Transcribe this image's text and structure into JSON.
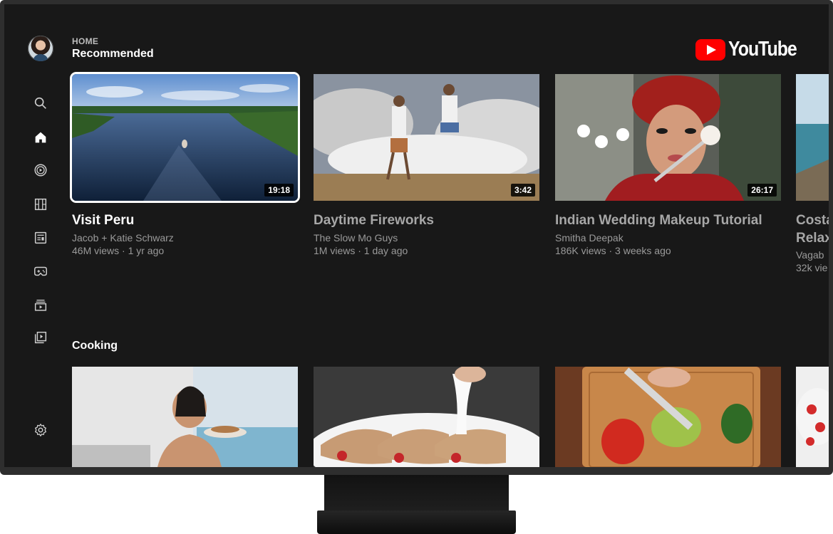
{
  "header": {
    "breadcrumb": "HOME",
    "section_title": "Recommended",
    "logo_text": "YouTube",
    "logo_color": "#ff0000"
  },
  "rail": {
    "icons": [
      "search-icon",
      "home-icon",
      "subscriptions-icon",
      "shorts-icon",
      "news-icon",
      "gaming-icon",
      "playlist-icon",
      "library-icon",
      "settings-icon"
    ],
    "active": "home-icon"
  },
  "recommended": {
    "videos": [
      {
        "title": "Visit Peru",
        "channel": "Jacob + Katie Schwarz",
        "meta": "46M views · 1 yr ago",
        "duration": "19:18"
      },
      {
        "title": "Daytime Fireworks",
        "channel": "The Slow Mo Guys",
        "meta": "1M views · 1 day ago",
        "duration": "3:42"
      },
      {
        "title": "Indian Wedding Makeup Tutorial",
        "channel": "Smitha Deepak",
        "meta": "186K views · 3 weeks ago",
        "duration": "26:17"
      },
      {
        "title": "Costa",
        "title2": "Relax",
        "channel": "Vagab",
        "meta": "32k vie"
      }
    ]
  },
  "cooking": {
    "label": "Cooking"
  }
}
